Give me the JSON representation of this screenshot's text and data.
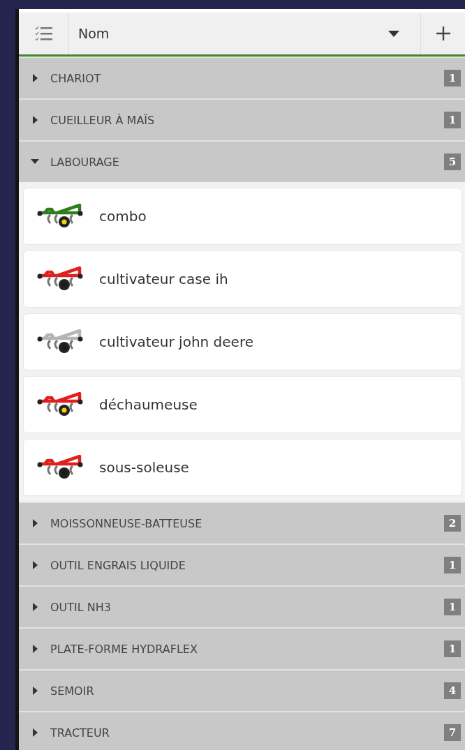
{
  "header": {
    "sort_label": "Nom"
  },
  "groups": [
    {
      "label": "CHARIOT",
      "count": "1",
      "expanded": false
    },
    {
      "label": "CUEILLEUR À MAÏS",
      "count": "1",
      "expanded": false
    },
    {
      "label": "LABOURAGE",
      "count": "5",
      "expanded": true,
      "items": [
        {
          "name": "combo",
          "color": "#2e7d1e",
          "yellow_hub": true
        },
        {
          "name": "cultivateur case ih",
          "color": "#e02020",
          "yellow_hub": false
        },
        {
          "name": "cultivateur john deere",
          "color": "#b4b4b4",
          "yellow_hub": false
        },
        {
          "name": "déchaumeuse",
          "color": "#e02020",
          "yellow_hub": true
        },
        {
          "name": "sous-soleuse",
          "color": "#e02020",
          "yellow_hub": false
        }
      ]
    },
    {
      "label": "MOISSONNEUSE-BATTEUSE",
      "count": "2",
      "expanded": false
    },
    {
      "label": "OUTIL ENGRAIS LIQUIDE",
      "count": "1",
      "expanded": false
    },
    {
      "label": "OUTIL NH3",
      "count": "1",
      "expanded": false
    },
    {
      "label": "PLATE-FORME HYDRAFLEX",
      "count": "1",
      "expanded": false
    },
    {
      "label": "SEMOIR",
      "count": "4",
      "expanded": false
    },
    {
      "label": "TRACTEUR",
      "count": "7",
      "expanded": false
    }
  ]
}
